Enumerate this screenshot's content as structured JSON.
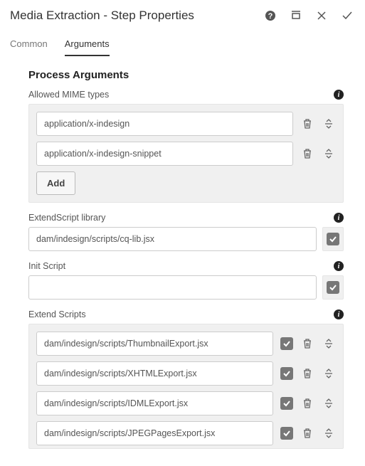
{
  "header": {
    "title": "Media Extraction - Step Properties"
  },
  "tabs": {
    "common": "Common",
    "arguments": "Arguments"
  },
  "section": {
    "title": "Process Arguments"
  },
  "mime": {
    "label": "Allowed MIME types",
    "items": [
      {
        "value": "application/x-indesign"
      },
      {
        "value": "application/x-indesign-snippet"
      }
    ],
    "add_label": "Add"
  },
  "extendscript_library": {
    "label": "ExtendScript library",
    "value": "dam/indesign/scripts/cq-lib.jsx"
  },
  "init_script": {
    "label": "Init Script",
    "value": ""
  },
  "extend_scripts": {
    "label": "Extend Scripts",
    "items": [
      {
        "value": "dam/indesign/scripts/ThumbnailExport.jsx"
      },
      {
        "value": "dam/indesign/scripts/XHTMLExport.jsx"
      },
      {
        "value": "dam/indesign/scripts/IDMLExport.jsx"
      },
      {
        "value": "dam/indesign/scripts/JPEGPagesExport.jsx"
      }
    ]
  }
}
